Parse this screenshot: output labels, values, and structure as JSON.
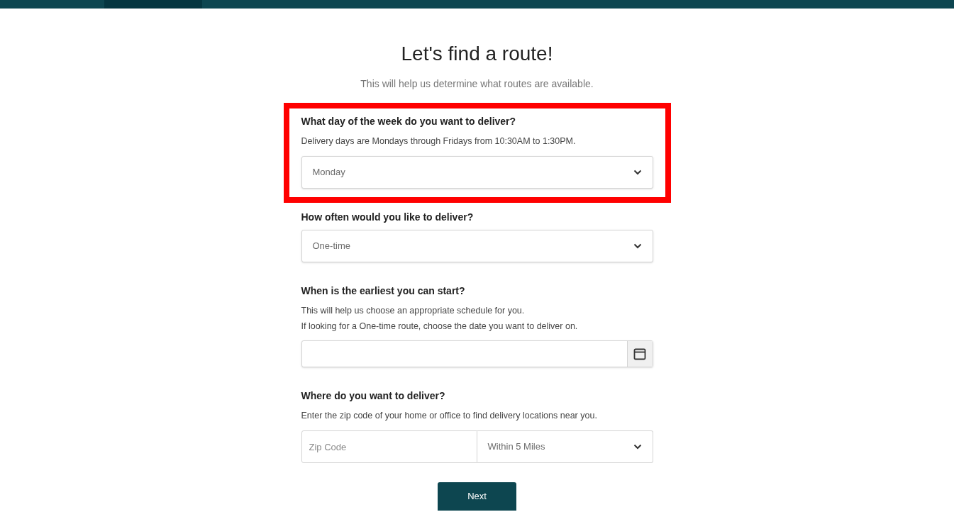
{
  "top_bar": {
    "segments": [
      {
        "selected": false
      },
      {
        "selected": true
      },
      {
        "selected": false
      }
    ]
  },
  "title": "Let's find a route!",
  "subtitle": "This will help us determine what routes are available.",
  "sections": [
    {
      "kind": "select",
      "highlighted": true,
      "label": "What day of the week do you want to deliver?",
      "hints": [
        "Delivery days are Mondays through Fridays from 10:30AM to 1:30PM."
      ],
      "value": "Monday"
    },
    {
      "kind": "select",
      "highlighted": false,
      "label": "How often would you like to deliver?",
      "value": "One-time"
    },
    {
      "kind": "date",
      "highlighted": false,
      "label": "When is the earliest you can start?",
      "hints": [
        "This will help us choose an appropriate schedule for you.",
        "If looking for a One-time route, choose the date you want to deliver on."
      ]
    },
    {
      "kind": "zip",
      "highlighted": false,
      "label": "Where do you want to deliver?",
      "hints": [
        "Enter the zip code of your home or office to find delivery locations near you."
      ],
      "placeholder": "Zip Code",
      "value": "Within 5 Miles"
    }
  ],
  "next_button": "Next"
}
